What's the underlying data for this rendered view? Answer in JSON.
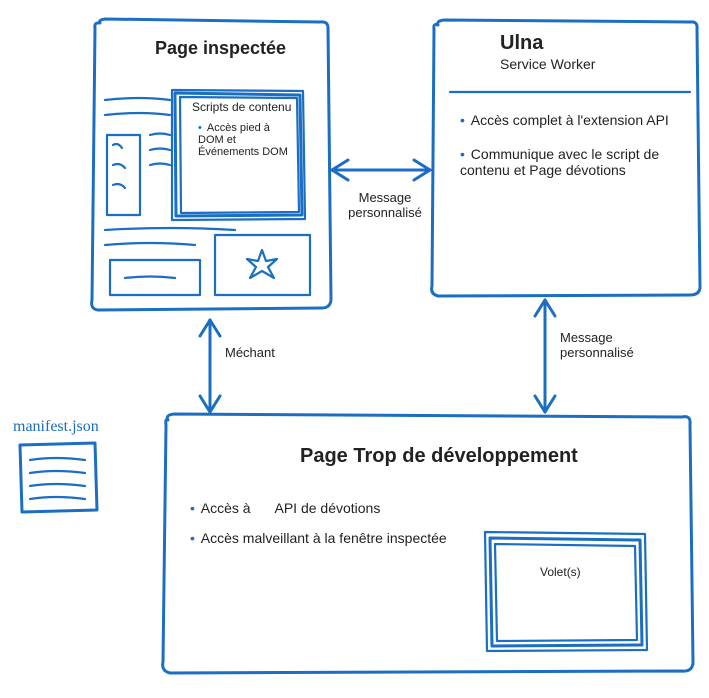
{
  "box_inspected": {
    "title": "Page inspectée",
    "scripts": {
      "title": "Scripts de contenu",
      "bullet": "Accès pied à DOM et Événements DOM"
    }
  },
  "box_service": {
    "title": "Ulna",
    "subtitle": "Service Worker",
    "bullets": [
      "Accès complet à l'extension API",
      "Communique avec le script de contenu et Page dévotions"
    ]
  },
  "box_devtools": {
    "title": "Page Trop de développement",
    "bullet1_prefix": "Accès à",
    "bullet1_suffix": "API de dévotions",
    "bullet2": "Accès malveillant à la fenêtre inspectée",
    "panels": "Volet(s)"
  },
  "arrows": {
    "top": "Message personnalisé",
    "left": "Méchant",
    "right": "Message personnalisé"
  },
  "manifest": "manifest.json"
}
